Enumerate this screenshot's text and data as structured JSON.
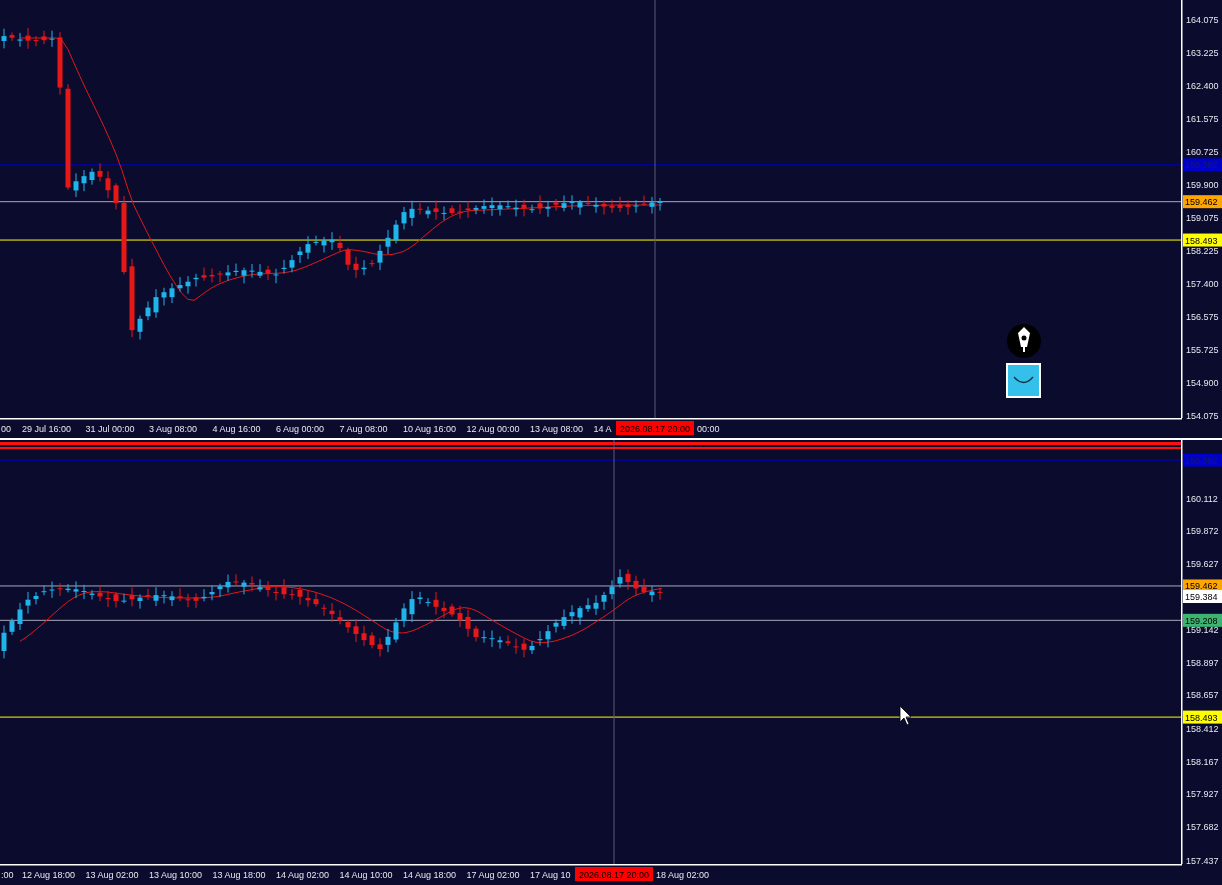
{
  "panels": [
    {
      "price_ticks": [
        "164.075",
        "163.225",
        "162.400",
        "161.575",
        "160.725",
        "159.900",
        "159.075",
        "158.225",
        "157.400",
        "156.575",
        "155.725",
        "154.900",
        "154.075"
      ],
      "price_tags": [
        {
          "value": "160.392",
          "color": "#0000c8",
          "kind": "level"
        },
        {
          "value": "159.462",
          "color": "#ffa500",
          "kind": "price"
        },
        {
          "value": "158.493",
          "color": "#ffff00",
          "kind": "level"
        }
      ],
      "time_labels": [
        "00",
        "29 Jul 16:00",
        "31 Jul 00:00",
        "3 Aug 08:00",
        "4 Aug 16:00",
        "6 Aug 00:00",
        "7 Aug 08:00",
        "10 Aug 16:00",
        "12 Aug 00:00",
        "13 Aug 08:00",
        "14 A",
        "00:00"
      ],
      "cursor_time": "2026.08.17 20:00"
    },
    {
      "price_ticks": [
        "160.112",
        "159.872",
        "159.627",
        "159.142",
        "158.897",
        "158.657",
        "158.412",
        "158.167",
        "157.927",
        "157.682",
        "157.437"
      ],
      "price_tags": [
        {
          "value": "160.392",
          "color": "#0000c8",
          "kind": "level"
        },
        {
          "value": "159.462",
          "color": "#ffa500",
          "kind": "price"
        },
        {
          "value": "159.384",
          "color": "#ffffff",
          "kind": "last"
        },
        {
          "value": "159.208",
          "color": "#3cb371",
          "kind": "price"
        },
        {
          "value": "158.493",
          "color": "#ffff00",
          "kind": "level"
        }
      ],
      "time_labels": [
        ":00",
        "12 Aug 18:00",
        "13 Aug 02:00",
        "13 Aug 10:00",
        "13 Aug 18:00",
        "14 Aug 02:00",
        "14 Aug 10:00",
        "14 Aug 18:00",
        "17 Aug 02:00",
        "17 Aug 10",
        "18 Aug 02:00"
      ],
      "cursor_time": "2026.08.17 20:00"
    }
  ]
}
